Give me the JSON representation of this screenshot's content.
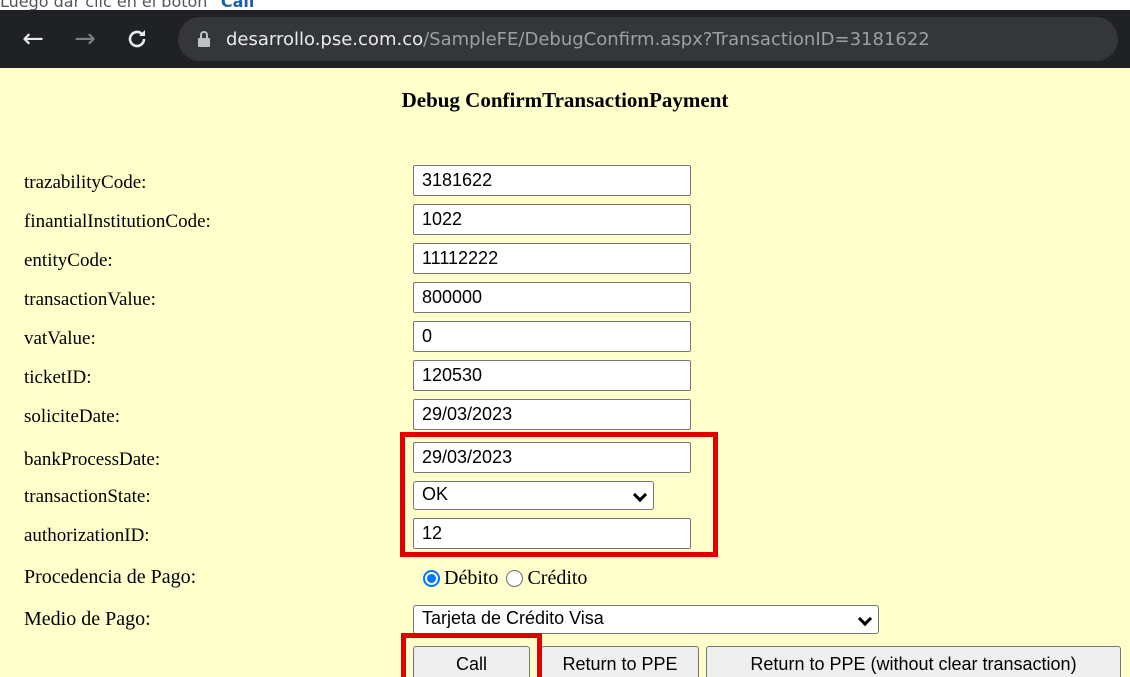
{
  "caption": {
    "prefix": "Luego dar clic en el botón ",
    "button_ref": "\"Call\""
  },
  "browser": {
    "back_icon": "arrow-left-icon",
    "forward_icon": "arrow-right-icon",
    "reload_icon": "reload-icon",
    "url_host": "desarrollo.pse.com.co",
    "url_path": "/SampleFE/DebugConfirm.aspx?TransactionID=3181622"
  },
  "page": {
    "title": "Debug ConfirmTransactionPayment",
    "fields": [
      {
        "label": "trazabilityCode:",
        "value": "3181622"
      },
      {
        "label": "finantialInstitutionCode:",
        "value": "1022"
      },
      {
        "label": "entityCode:",
        "value": "11112222"
      },
      {
        "label": "transactionValue:",
        "value": "800000"
      },
      {
        "label": "vatValue:",
        "value": "0"
      },
      {
        "label": "ticketID:",
        "value": "120530"
      },
      {
        "label": "soliciteDate:",
        "value": "29/03/2023"
      },
      {
        "label": "bankProcessDate:",
        "value": "29/03/2023"
      }
    ],
    "transaction_state": {
      "label": "transactionState:",
      "value": "OK"
    },
    "authorization": {
      "label": "authorizationID:",
      "value": "12"
    },
    "procedencia": {
      "label": "Procedencia de Pago:",
      "options": [
        {
          "label": "Débito",
          "checked": true
        },
        {
          "label": "Crédito",
          "checked": false
        }
      ]
    },
    "medio": {
      "label": "Medio de Pago:",
      "value": "Tarjeta de Crédito Visa"
    },
    "buttons": {
      "call": "Call",
      "return": "Return to PPE",
      "return_no_clear": "Return to PPE (without clear transaction)"
    },
    "highlight_color": "#e00000",
    "background_color": "#ffffcc"
  }
}
